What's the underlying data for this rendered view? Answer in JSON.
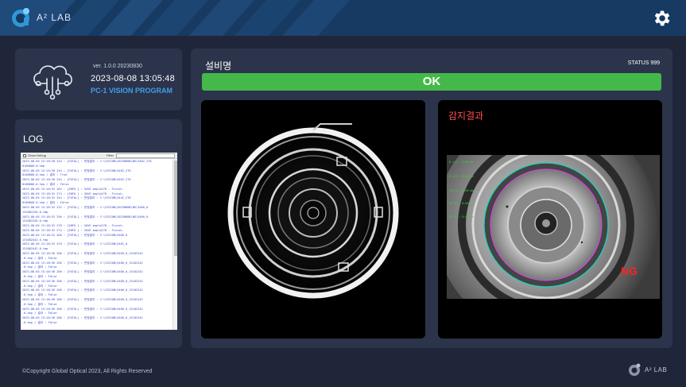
{
  "header": {
    "logo_text": "A² LAB",
    "settings_icon": "gear-icon"
  },
  "info": {
    "version": "ver. 1.0.0 20230830",
    "datetime": "2023-08-08 13:05:48",
    "program": "PC-1 VISION PROGRAM",
    "icon": "cloud-circuit-icon"
  },
  "log": {
    "title": "LOG",
    "show_debug": "Show Debug",
    "filter_label": "Filter",
    "lines": [
      "2023-08-05 15:18:50 244 : [FATAL] : 판정결과 : C:\\VISION\\20230808\\NG\\5462_270",
      "0100800.0.tmp",
      "2023-08-05 15:18:50 244 : [FATAL] : 판정결과 : C:\\VISION\\5462_270",
      "0100800.0.tmp / 결과 : True",
      "2023-08-05 15:18:50 244 : [FATAL] : 판정결과 : C:\\VISION\\5462_270",
      "0100800.0.tmp / 결과 : False",
      "2023-08-05 15:18:52 262 : [INFO ] : SAVE mapla270 - Finish.",
      "2023-08-05 15:18:52 274 : [INFO ] : SAVE mapla270 - Finish.",
      "2023-08-05 15:18:52 244 : [FATAL] : 판정결과 : C:\\VISION\\5442_270",
      "0100800.0.tmp / 결과 : False",
      "2023-08-05 15:18:52 232 : [FATAL] : 판정결과 : C:\\VISION\\20230808\\NG\\5460_0",
      "131082226.0.tmp",
      "2023-08-05 15:18:52 256 : [FATAL] : 판정결과 : C:\\VISION\\20230808\\NG\\5460_0",
      "131082226.0.tmp",
      "2023-08-05 15:18:52 270 : [INFO ] : SAVE mapla270 - Finish.",
      "2023-08-05 15:18:52 274 : [INFO ] : SAVE mapla270 - Finish.",
      "2023-08-05 15:18:52 466 : [FATAL] : 판정결과 : C:\\VISION\\5460_0",
      "131082442.0.tmp",
      "2023-08-05 15:18:52 470 : [FATAL] : 판정결과 : C:\\VISION\\5461_0",
      "131082442.0.tmp",
      "2023-08-05 15:18:56 266 : [FATAL] : 판정결과 : C:\\VISION\\5460_0_15102242",
      ".0.tmp / 결과 : False",
      "2023-08-05 15:18:56 266 : [FATAL] : 판정결과 : C:\\VISION\\5460_0_15102242",
      ".0.tmp / 결과 : False",
      "2023-08-05 15:18:56 266 : [FATAL] : 판정결과 : C:\\VISION\\5460_0_15102242",
      ".0.tmp / 결과 : False",
      "2023-08-05 15:18:56 266 : [FATAL] : 판정결과 : C:\\VISION\\5460_0_15102242",
      ".0.tmp / 결과 : False",
      "2023-08-05 15:18:56 266 : [FATAL] : 판정결과 : C:\\VISION\\5460_0_15102242",
      ".0.tmp / 결과 : False",
      "2023-08-05 15:18:56 266 : [FATAL] : 판정결과 : C:\\VISION\\5460_0_15102242",
      ".0.tmp / 결과 : False",
      "2023-08-05 15:18:56 266 : [FATAL] : 판정결과 : C:\\VISION\\5460_0_15102242",
      ".0.tmp / 결과 : False",
      "2023-08-05 15:18:56 266 : [FATAL] : 판정결과 : C:\\VISION\\5460_0_15102242",
      ".0.tmp / 결과 : False"
    ]
  },
  "main": {
    "equipment_name": "설비명",
    "status": "STATUS 999",
    "result": "OK",
    "result_color": "#44b94a"
  },
  "inspection": {
    "title": "감지결과",
    "verdict": "NG",
    "measurements": [
      "R-1/1 : 0.00 mm",
      "R-2/2 : 0.00 mm",
      "1/2-R : 0.00 mm",
      "R2-T1 : 0.00 mm",
      "R2-T2 : 0.00 mm"
    ]
  },
  "footer": {
    "copyright": "©Copyright Global Optical 2023, All Rights Reserved",
    "logo_text": "A² LAB"
  }
}
